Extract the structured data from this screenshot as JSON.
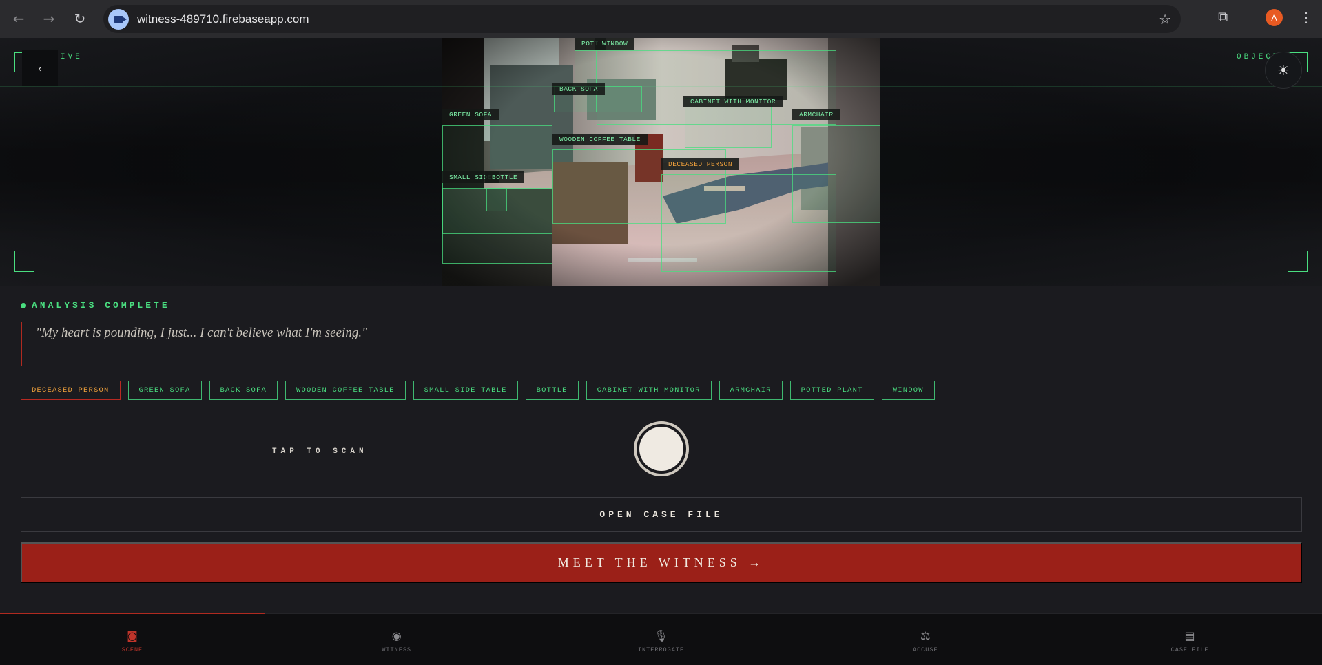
{
  "browser": {
    "url": "witness-489710.firebaseapp.com",
    "profile_initial": "A",
    "icons": {
      "back": "arrow-left-icon",
      "forward": "arrow-right-icon",
      "reload": "reload-icon",
      "bookmark": "star-icon",
      "extensions": "puzzle-icon",
      "menu": "kebab-menu-icon"
    }
  },
  "viewfinder": {
    "left_label": "IVE",
    "right_label": "OBJECT",
    "back_glyph": "‹",
    "settings_glyph": "☀",
    "detections": [
      {
        "label": "POTT",
        "warn": false
      },
      {
        "label": "WINDOW",
        "warn": false
      },
      {
        "label": "BACK SOFA",
        "warn": false
      },
      {
        "label": "CABINET WITH MONITOR",
        "warn": false
      },
      {
        "label": "GREEN SOFA",
        "warn": false
      },
      {
        "label": "ARMCHAIR",
        "warn": false
      },
      {
        "label": "WOODEN COFFEE TABLE",
        "warn": false
      },
      {
        "label": "DECEASED PERSON",
        "warn": true
      },
      {
        "label": "SMALL SIDE",
        "warn": false
      },
      {
        "label": "BOTTLE",
        "warn": false
      }
    ]
  },
  "analysis": {
    "status": "ANALYSIS COMPLETE",
    "quote": "\"My heart is pounding, I just... I can't believe what I'm seeing.\""
  },
  "tags": [
    {
      "label": "DECEASED PERSON",
      "warn": true
    },
    {
      "label": "GREEN SOFA",
      "warn": false
    },
    {
      "label": "BACK SOFA",
      "warn": false
    },
    {
      "label": "WOODEN COFFEE TABLE",
      "warn": false
    },
    {
      "label": "SMALL SIDE TABLE",
      "warn": false
    },
    {
      "label": "BOTTLE",
      "warn": false
    },
    {
      "label": "CABINET WITH MONITOR",
      "warn": false
    },
    {
      "label": "ARMCHAIR",
      "warn": false
    },
    {
      "label": "POTTED PLANT",
      "warn": false
    },
    {
      "label": "WINDOW",
      "warn": false
    }
  ],
  "scan": {
    "tap_label": "TAP TO SCAN"
  },
  "actions": {
    "open_case_file": "OPEN CASE FILE",
    "meet_witness": "MEET THE WITNESS →"
  },
  "bottom_nav": [
    {
      "label": "SCENE",
      "icon": "camera-icon",
      "glyph": "◙",
      "active": true
    },
    {
      "label": "WITNESS",
      "icon": "eye-icon",
      "glyph": "◉",
      "active": false
    },
    {
      "label": "INTERROGATE",
      "icon": "microphone-icon",
      "glyph": "🎙",
      "active": false
    },
    {
      "label": "ACCUSE",
      "icon": "scales-icon",
      "glyph": "⚖",
      "active": false
    },
    {
      "label": "CASE FILE",
      "icon": "document-icon",
      "glyph": "▤",
      "active": false
    }
  ],
  "colors": {
    "accent_green": "#4ade80",
    "accent_red": "#9b2018",
    "warn_orange": "#f0a13c",
    "background": "#1b1b1f"
  }
}
